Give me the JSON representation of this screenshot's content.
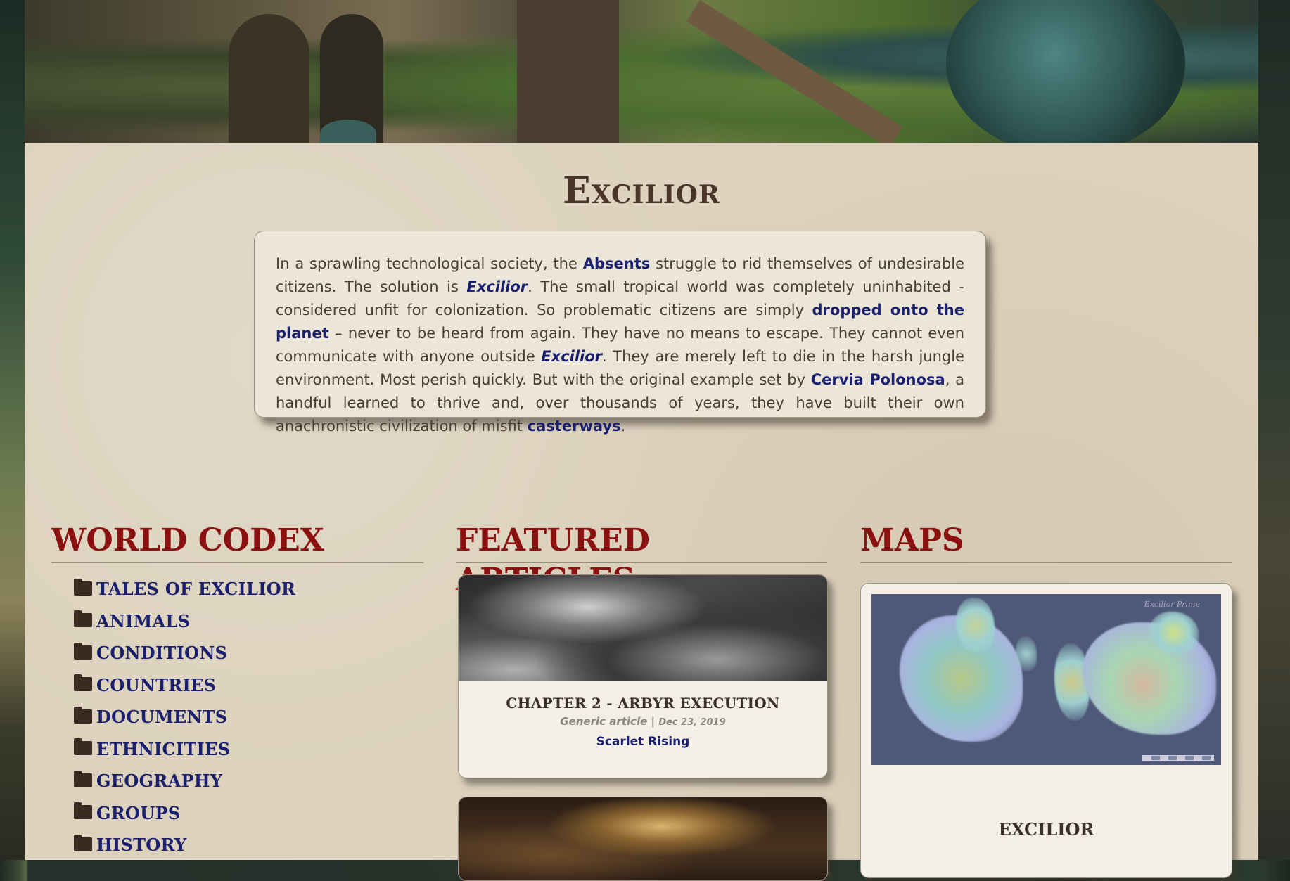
{
  "world_title": "Excilior",
  "intro": {
    "t1": "In a sprawling technological society, the ",
    "l1": "Absents",
    "t2": " struggle to rid themselves of undesirable citizens. The solution is ",
    "l2": "Excilior",
    "t3": ". The small tropical world was completely uninhabited - considered unfit for colonization. So problematic citizens are simply ",
    "l3": "dropped onto the planet",
    "t4": " – never to be heard from again. They have no means to escape. They cannot even communicate with anyone outside ",
    "l4": "Excilior",
    "t5": ". They are merely left to die in the harsh jungle environment. Most perish quickly. But with the original example set by ",
    "l5": "Cervia Polonosa",
    "t6": ", a handful learned to thrive and, over thousands of years, they have built their own anachronistic civilization of misfit ",
    "l6": "casterways",
    "t7": "."
  },
  "codex": {
    "heading": "WORLD CODEX",
    "items": [
      {
        "label": "TALES OF EXCILIOR",
        "icon": "folder-icon"
      },
      {
        "label": "ANIMALS",
        "icon": "folder-icon"
      },
      {
        "label": "CONDITIONS",
        "icon": "folder-icon"
      },
      {
        "label": "COUNTRIES",
        "icon": "folder-icon"
      },
      {
        "label": "DOCUMENTS",
        "icon": "folder-icon"
      },
      {
        "label": "ETHNICITIES",
        "icon": "folder-icon"
      },
      {
        "label": "GEOGRAPHY",
        "icon": "folder-icon"
      },
      {
        "label": "GROUPS",
        "icon": "folder-icon"
      },
      {
        "label": "HISTORY",
        "icon": "folder-icon"
      }
    ]
  },
  "featured": {
    "heading": "FEATURED ARTICLES",
    "articles": [
      {
        "title": "CHAPTER 2 - ARBYR EXECUTION",
        "type": "Generic article | ",
        "date": "Dec 23, 2019",
        "link": "Scarlet Rising"
      }
    ]
  },
  "maps": {
    "heading": "MAPS",
    "map_caption": "EXCILIOR",
    "map_stamp": "Excilior Prime"
  },
  "colors": {
    "heading_red": "#8b1010",
    "link_navy": "#1a1f6e",
    "parchment": "#dcd2bd",
    "title_brown": "#4a3628"
  }
}
